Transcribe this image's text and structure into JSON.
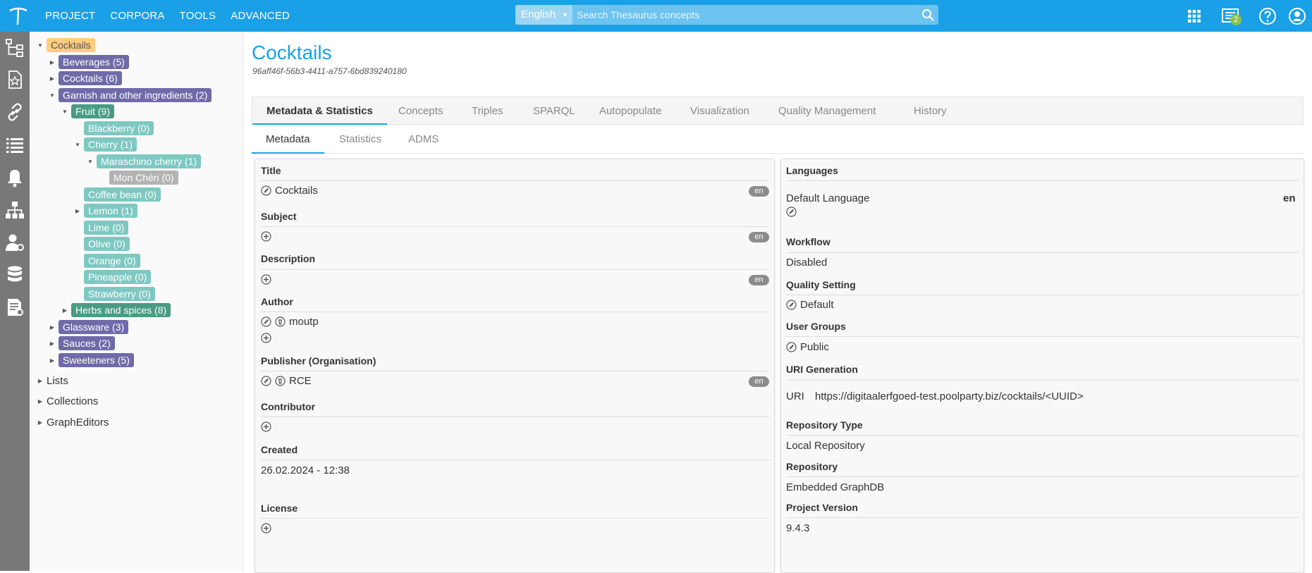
{
  "menu": [
    "PROJECT",
    "CORPORA",
    "TOOLS",
    "ADVANCED"
  ],
  "search": {
    "language": "English",
    "placeholder": "Search Thesaurus concepts"
  },
  "notifications_count": "2",
  "tree": {
    "root": "Cocktails",
    "nodes": [
      "Beverages (5)",
      "Cocktails (6)",
      "Garnish and other ingredients (2)",
      "Fruit (9)",
      "Blackberry (0)",
      "Cherry (1)",
      "Maraschino cherry (1)",
      "Mon Chéri (0)",
      "Coffee bean (0)",
      "Lemon (1)",
      "Lime (0)",
      "Olive (0)",
      "Orange (0)",
      "Pineapple (0)",
      "Strawberry (0)",
      "Herbs and spices (8)",
      "Glassware (3)",
      "Sauces (2)",
      "Sweeteners (5)"
    ],
    "sections": [
      "Lists",
      "Collections",
      "GraphEditors"
    ]
  },
  "page": {
    "title": "Cocktails",
    "id": "96aff46f-56b3-4411-a757-6bd839240180"
  },
  "tabs": [
    "Metadata & Statistics",
    "Concepts",
    "Triples",
    "SPARQL",
    "Autopopulate",
    "Visualization",
    "Quality Management",
    "History"
  ],
  "subtabs": [
    "Metadata",
    "Statistics",
    "ADMS"
  ],
  "metadata": {
    "title_label": "Title",
    "title_value": "Cocktails",
    "subject_label": "Subject",
    "description_label": "Description",
    "author_label": "Author",
    "author_value": "moutp",
    "publisher_label": "Publisher (Organisation)",
    "publisher_value": "RCE",
    "contributor_label": "Contributor",
    "created_label": "Created",
    "created_value": "26.02.2024 - 12:38",
    "license_label": "License",
    "lang_tag": "en"
  },
  "settings": {
    "languages_label": "Languages",
    "default_language_label": "Default Language",
    "default_language_value": "en",
    "workflow_label": "Workflow",
    "workflow_value": "Disabled",
    "quality_label": "Quality Setting",
    "quality_value": "Default",
    "groups_label": "User Groups",
    "groups_value": "Public",
    "uri_label": "URI Generation",
    "uri_key": "URI",
    "uri_value": "https://digitaalerfgoed-test.poolparty.biz/cocktails/<UUID>",
    "repo_type_label": "Repository Type",
    "repo_type_value": "Local Repository",
    "repo_label": "Repository",
    "repo_value": "Embedded GraphDB",
    "version_label": "Project Version",
    "version_value": "9.4.3"
  },
  "colors": {
    "accent": "#1aa0e6",
    "rail": "#787878",
    "root_tag": "#ffcc80",
    "level1_tag": "#6f6aa8",
    "level2_tag": "#4a9b83",
    "level3_tag": "#7ec8c2",
    "leaf_tag": "#b3b3b3"
  }
}
